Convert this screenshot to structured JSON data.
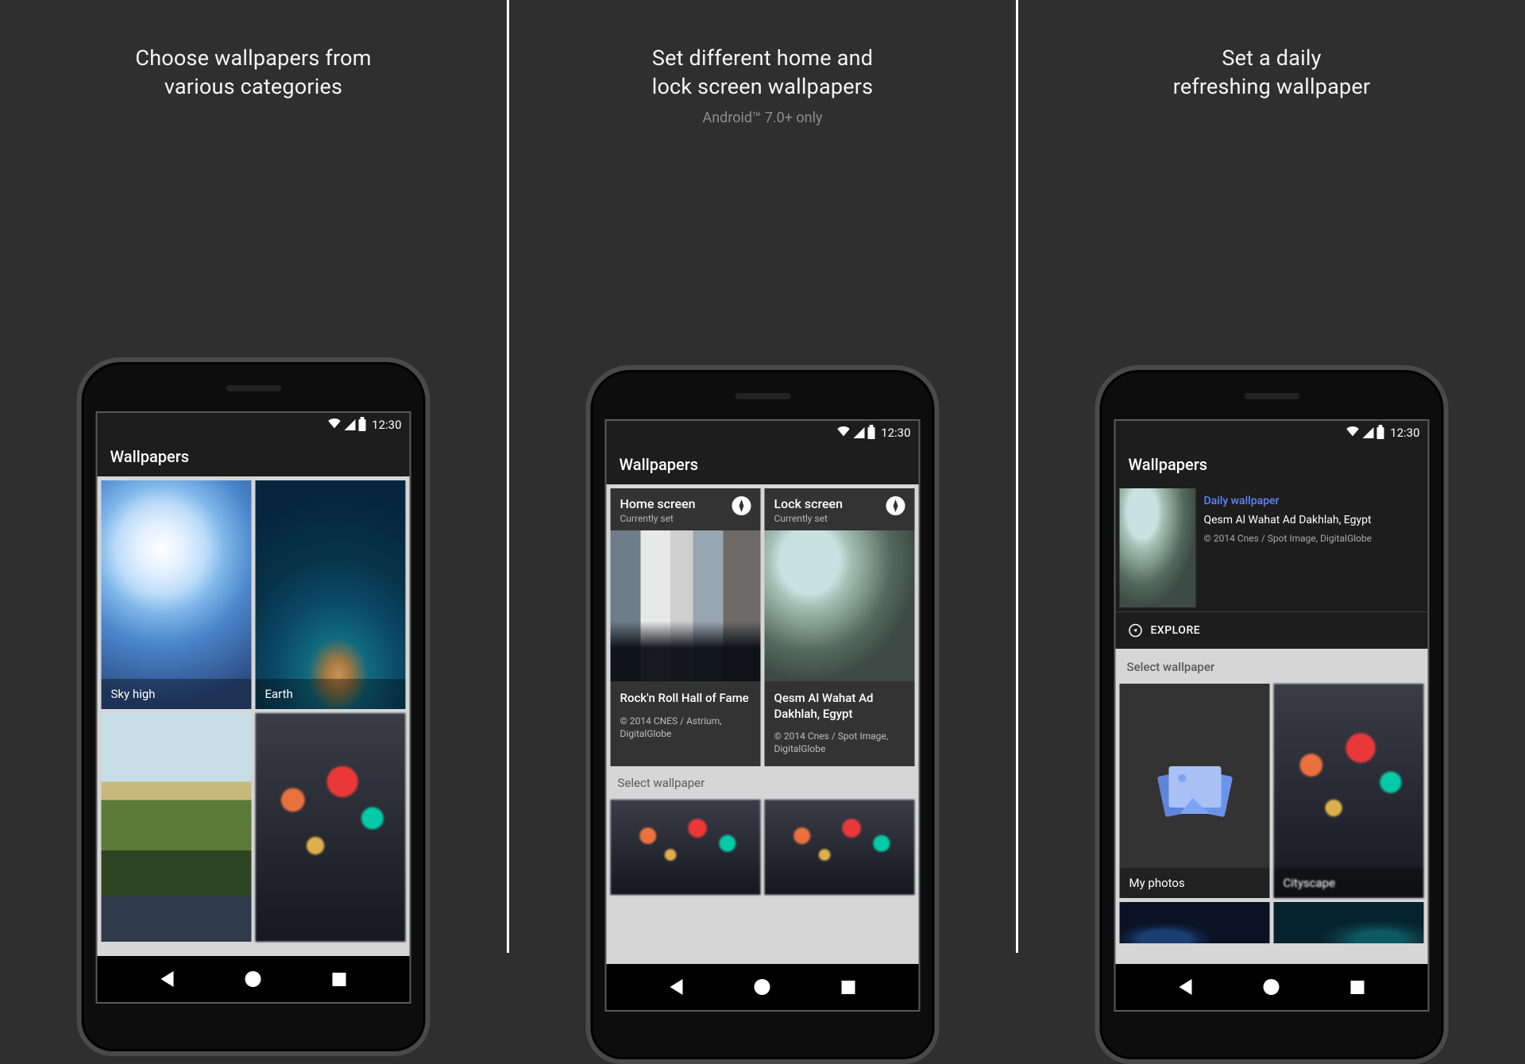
{
  "status": {
    "time": "12:30"
  },
  "app": {
    "title": "Wallpapers"
  },
  "panel1": {
    "title_l1": "Choose wallpapers from",
    "title_l2": "various categories",
    "cells": [
      {
        "label": "Sky high"
      },
      {
        "label": "Earth"
      },
      {
        "label": ""
      },
      {
        "label": ""
      }
    ]
  },
  "panel2": {
    "title_l1": "Set different home and",
    "title_l2": "lock screen wallpapers",
    "subtitle": "Android™ 7.0+ only",
    "home": {
      "heading": "Home screen",
      "sub": "Currently set",
      "name": "Rock'n Roll Hall of Fame",
      "credit": "© 2014 CNES / Astrium, DigitalGlobe"
    },
    "lock": {
      "heading": "Lock screen",
      "sub": "Currently set",
      "name": "Qesm Al Wahat Ad Dakhlah, Egypt",
      "credit": "© 2014 Cnes / Spot Image, DigitalGlobe"
    },
    "select_label": "Select wallpaper"
  },
  "panel3": {
    "title_l1": "Set a daily",
    "title_l2": "refreshing wallpaper",
    "daily_label": "Daily wallpaper",
    "location": "Qesm Al Wahat Ad Dakhlah, Egypt",
    "credit": "© 2014 Cnes / Spot Image, DigitalGlobe",
    "explore": "EXPLORE",
    "select_label": "Select wallpaper",
    "cells": [
      {
        "label": "My photos"
      },
      {
        "label": "Cityscape"
      }
    ]
  }
}
